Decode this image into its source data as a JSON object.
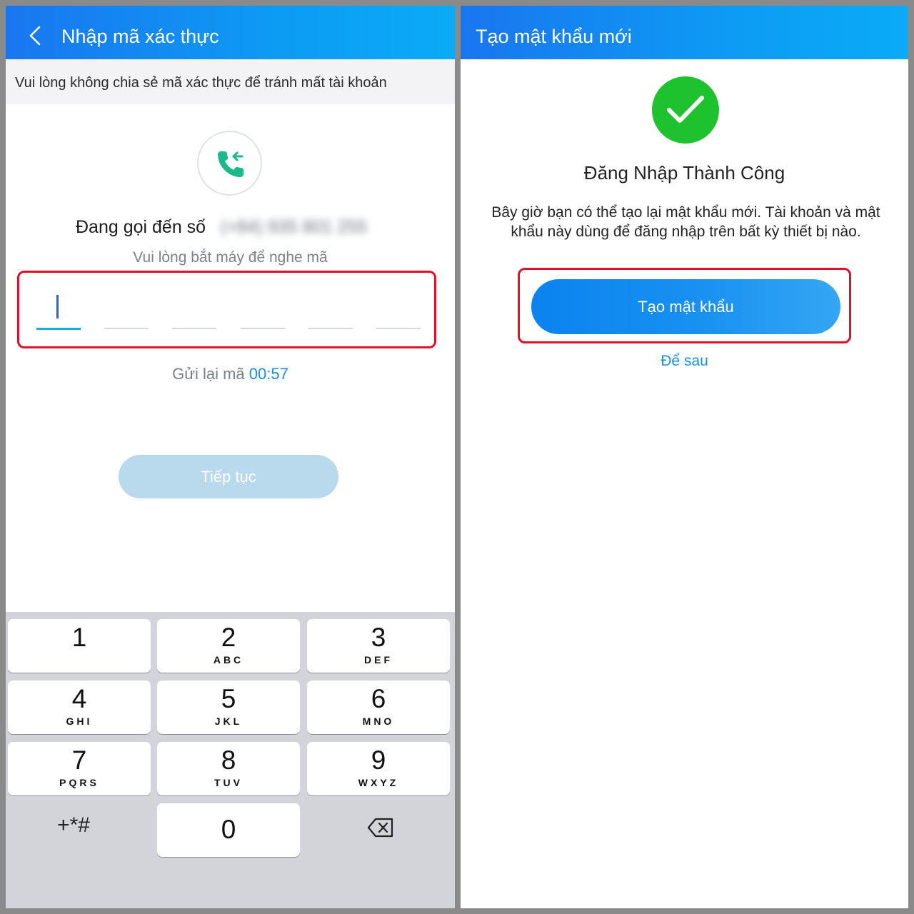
{
  "left": {
    "header": {
      "title": "Nhập mã xác thực"
    },
    "notice": "Vui lòng không chia sẻ mã xác thực để tránh mất tài khoản",
    "calling_label": "Đang gọi đến số",
    "phone_number": "(+84) 935 801 255",
    "hint": "Vui lòng bắt máy để nghe mã",
    "code_slots": 6,
    "resend": {
      "label": "Gửi lại mã",
      "timer": "00:57"
    },
    "continue_label": "Tiếp tục",
    "keypad": {
      "keys": [
        {
          "digit": "1",
          "letters": ""
        },
        {
          "digit": "2",
          "letters": "ABC"
        },
        {
          "digit": "3",
          "letters": "DEF"
        },
        {
          "digit": "4",
          "letters": "GHI"
        },
        {
          "digit": "5",
          "letters": "JKL"
        },
        {
          "digit": "6",
          "letters": "MNO"
        },
        {
          "digit": "7",
          "letters": "PQRS"
        },
        {
          "digit": "8",
          "letters": "TUV"
        },
        {
          "digit": "9",
          "letters": "WXYZ"
        },
        {
          "digit": "0",
          "letters": ""
        }
      ],
      "symbols": "+*#",
      "delete_icon": "backspace-icon"
    }
  },
  "right": {
    "header": {
      "title": "Tạo mật khẩu mới"
    },
    "success_icon": "checkmark-icon",
    "success_title": "Đăng Nhập Thành Công",
    "description": "Bây giờ bạn có thể tạo lại mật khẩu mới. Tài khoản và mật khẩu này dùng để đăng nhập trên bất kỳ thiết bị nào.",
    "create_label": "Tạo mật khẩu",
    "later_label": "Để sau"
  },
  "colors": {
    "header_gradient_start": "#1a76f0",
    "header_gradient_end": "#0aabf7",
    "highlight_border": "#e0102a",
    "success_green": "#1ec12e",
    "link_blue": "#1a8fe8",
    "disabled_button": "#b9d9ec",
    "keypad_background": "#d2d4da"
  }
}
